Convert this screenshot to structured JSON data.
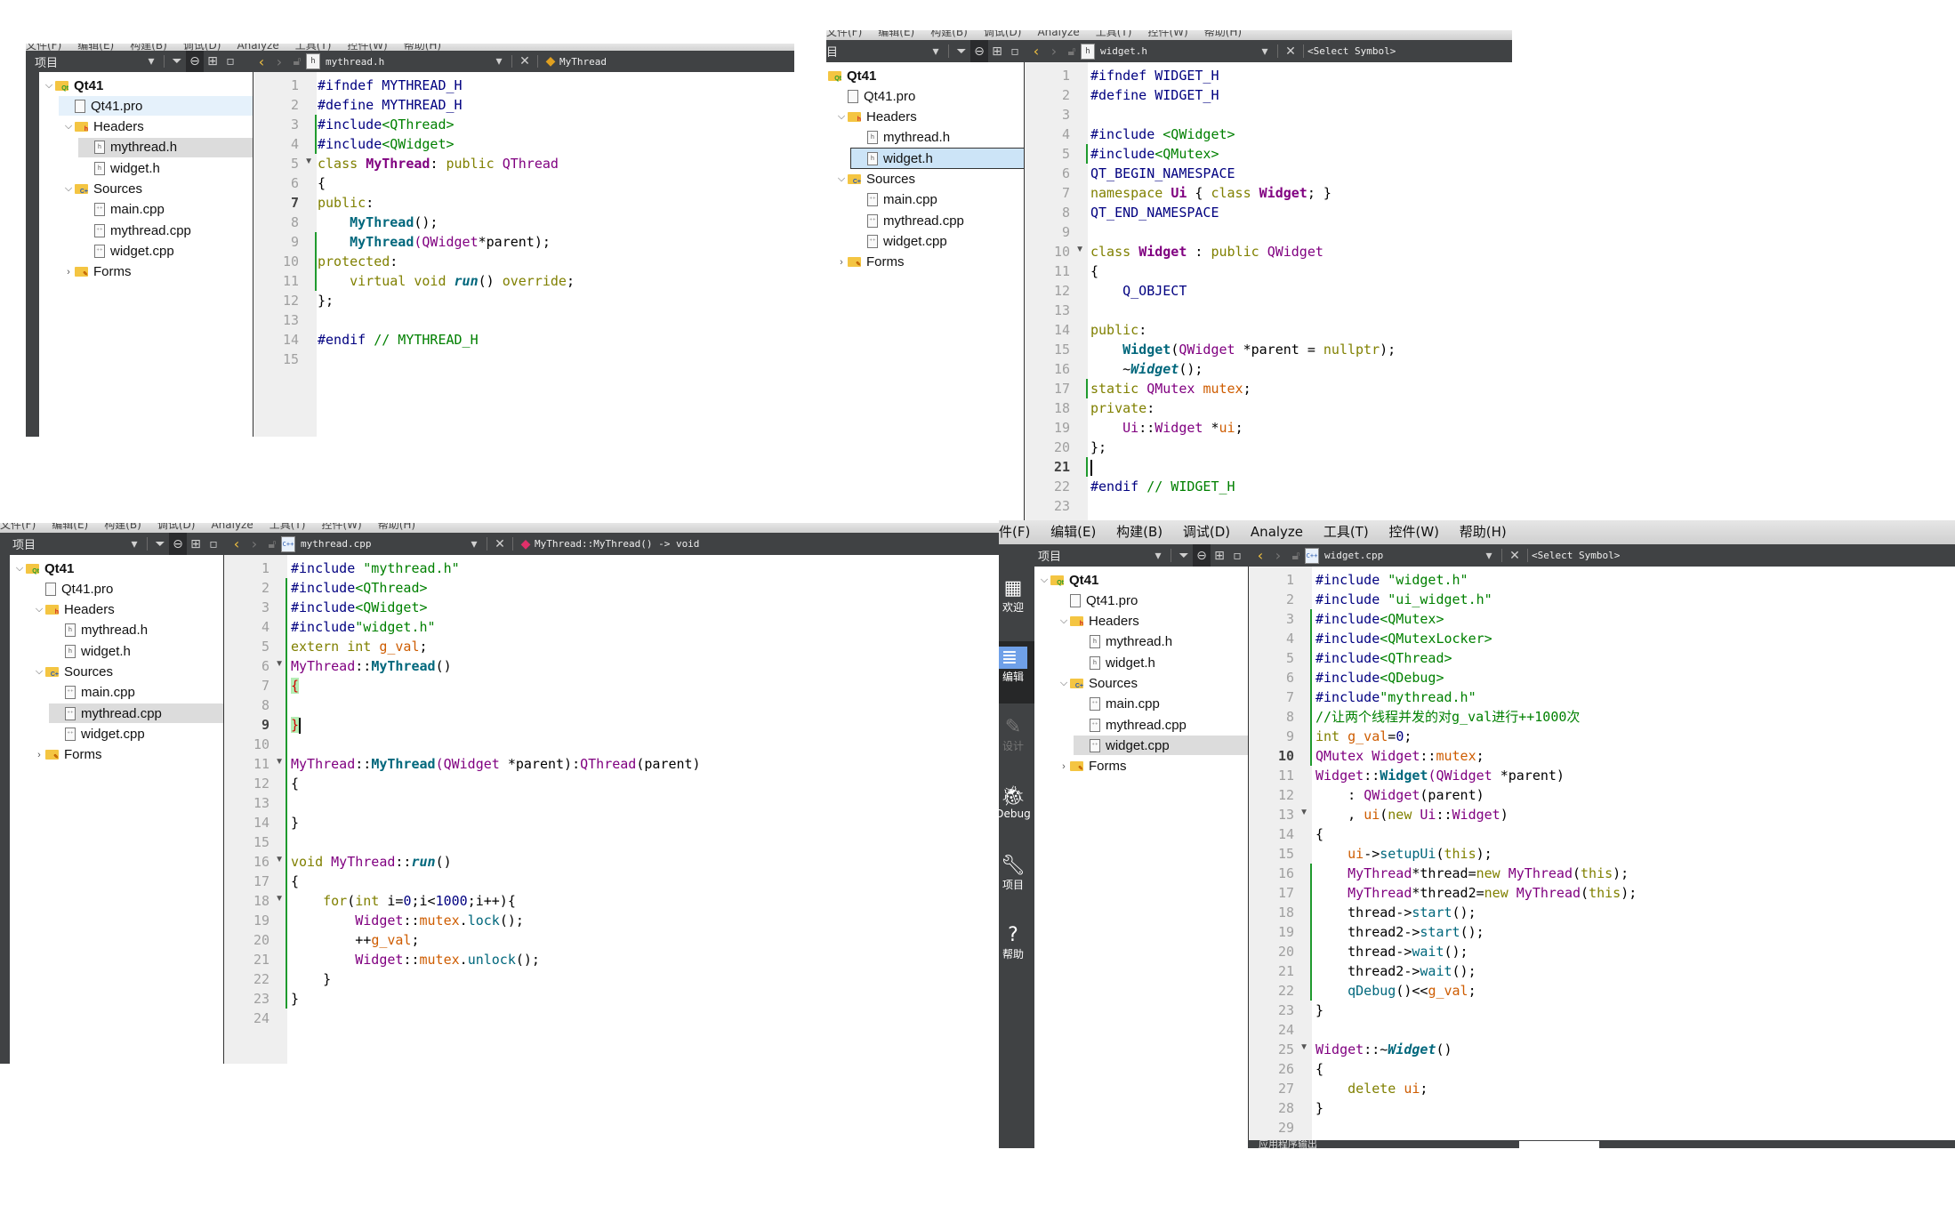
{
  "menu": {
    "items": [
      "文件(F)",
      "编辑(E)",
      "构建(B)",
      "调试(D)",
      "Analyze",
      "工具(T)",
      "控件(W)",
      "帮助(H)"
    ],
    "partial_first": "件(F)"
  },
  "toolbar": {
    "project_label": "项目",
    "project_label_partial": "目",
    "select_symbol": "<Select Symbol>"
  },
  "tree": {
    "project": "Qt41",
    "pro_file": "Qt41.pro",
    "headers_label": "Headers",
    "headers": [
      "mythread.h",
      "widget.h"
    ],
    "sources_label": "Sources",
    "sources": [
      "main.cpp",
      "mythread.cpp",
      "widget.cpp"
    ],
    "forms_label": "Forms"
  },
  "panels": [
    {
      "id": "mythread-h",
      "open_file": "mythread.h",
      "symbol": "MyThread",
      "selected_tree_item": "mythread.h",
      "line_count": 15,
      "current_line": 7,
      "lines": [
        [
          [
            "pp",
            "#ifndef MYTHREAD_H"
          ]
        ],
        [
          [
            "pp",
            "#define MYTHREAD_H"
          ]
        ],
        [
          [
            "pp",
            "#include"
          ],
          [
            "str",
            "<QThread>"
          ]
        ],
        [
          [
            "pp",
            "#include"
          ],
          [
            "str",
            "<QWidget>"
          ]
        ],
        [
          [
            "kw",
            "class "
          ],
          [
            "clsb",
            "MyThread"
          ],
          [
            "",
            ": "
          ],
          [
            "kw",
            "public "
          ],
          [
            "typ",
            "QThread"
          ]
        ],
        [
          [
            "",
            "{"
          ]
        ],
        [
          [
            "kw",
            "public"
          ],
          [
            "",
            ":"
          ]
        ],
        [
          [
            "",
            "    "
          ],
          [
            "fnb",
            "MyThread"
          ],
          [
            "",
            "();"
          ]
        ],
        [
          [
            "",
            "    "
          ],
          [
            "fnb",
            "MyThread"
          ],
          [
            "typ",
            "(QWidget"
          ],
          [
            "",
            "*parent);"
          ]
        ],
        [
          [
            "kw",
            "protected"
          ],
          [
            "",
            ":"
          ]
        ],
        [
          [
            "",
            "    "
          ],
          [
            "kw",
            "virtual void "
          ],
          [
            "fni",
            "run"
          ],
          [
            "",
            "() "
          ],
          [
            "kw",
            "override"
          ],
          [
            "",
            ";"
          ]
        ],
        [
          [
            "",
            "};"
          ]
        ],
        [
          [
            "",
            ""
          ]
        ],
        [
          [
            "pp",
            "#endif "
          ],
          [
            "cmt",
            "// MYTHREAD_H"
          ]
        ],
        [
          [
            "",
            ""
          ]
        ]
      ]
    },
    {
      "id": "widget-h",
      "open_file": "widget.h",
      "symbol": "<Select Symbol>",
      "selected_tree_item": "widget.h",
      "line_count": 23,
      "current_line": 21,
      "lines": [
        [
          [
            "pp",
            "#ifndef WIDGET_H"
          ]
        ],
        [
          [
            "pp",
            "#define WIDGET_H"
          ]
        ],
        [
          [
            "",
            ""
          ]
        ],
        [
          [
            "pp",
            "#include "
          ],
          [
            "str",
            "<QWidget>"
          ]
        ],
        [
          [
            "pp",
            "#include"
          ],
          [
            "str",
            "<QMutex>"
          ]
        ],
        [
          [
            "pp",
            "QT_BEGIN_NAMESPACE"
          ]
        ],
        [
          [
            "kw",
            "namespace "
          ],
          [
            "clsb",
            "Ui"
          ],
          [
            "",
            " { "
          ],
          [
            "kw",
            "class "
          ],
          [
            "clsb",
            "Widget"
          ],
          [
            "",
            "; }"
          ]
        ],
        [
          [
            "pp",
            "QT_END_NAMESPACE"
          ]
        ],
        [
          [
            "",
            ""
          ]
        ],
        [
          [
            "kw",
            "class "
          ],
          [
            "clsb",
            "Widget"
          ],
          [
            "",
            " : "
          ],
          [
            "kw",
            "public "
          ],
          [
            "typ",
            "QWidget"
          ]
        ],
        [
          [
            "",
            "{"
          ]
        ],
        [
          [
            "",
            "    "
          ],
          [
            "pp",
            "Q_OBJECT"
          ]
        ],
        [
          [
            "",
            ""
          ]
        ],
        [
          [
            "kw",
            "public"
          ],
          [
            "",
            ":"
          ]
        ],
        [
          [
            "",
            "    "
          ],
          [
            "fnb",
            "Widget"
          ],
          [
            "",
            "("
          ],
          [
            "typ",
            "QWidget"
          ],
          [
            "",
            " *parent = "
          ],
          [
            "kw",
            "nullptr"
          ],
          [
            "",
            ");"
          ]
        ],
        [
          [
            "",
            "    ~"
          ],
          [
            "fni",
            "Widget"
          ],
          [
            "",
            "();"
          ]
        ],
        [
          [
            "kw",
            "static "
          ],
          [
            "typ",
            "QMutex "
          ],
          [
            "mem",
            "mutex"
          ],
          [
            "",
            ";"
          ]
        ],
        [
          [
            "kw",
            "private"
          ],
          [
            "",
            ":"
          ]
        ],
        [
          [
            "",
            "    "
          ],
          [
            "typ",
            "Ui"
          ],
          [
            "",
            "::"
          ],
          [
            "typ",
            "Widget"
          ],
          [
            "",
            " *"
          ],
          [
            "mem",
            "ui"
          ],
          [
            "",
            ";"
          ]
        ],
        [
          [
            "",
            "};"
          ]
        ],
        [
          [
            "caret",
            ""
          ]
        ],
        [
          [
            "pp",
            "#endif "
          ],
          [
            "cmt",
            "// WIDGET_H"
          ]
        ],
        [
          [
            "",
            ""
          ]
        ]
      ]
    },
    {
      "id": "mythread-cpp",
      "open_file": "mythread.cpp",
      "symbol": "MyThread::MyThread() -> void",
      "selected_tree_item": "mythread.cpp",
      "line_count": 24,
      "current_line": 9,
      "lines": [
        [
          [
            "pp",
            "#include "
          ],
          [
            "str",
            "\"mythread.h\""
          ]
        ],
        [
          [
            "pp",
            "#include"
          ],
          [
            "str",
            "<QThread>"
          ]
        ],
        [
          [
            "pp",
            "#include"
          ],
          [
            "str",
            "<QWidget>"
          ]
        ],
        [
          [
            "pp",
            "#include"
          ],
          [
            "str",
            "\"widget.h\""
          ]
        ],
        [
          [
            "kw",
            "extern int "
          ],
          [
            "mem",
            "g_val"
          ],
          [
            "",
            ";"
          ]
        ],
        [
          [
            "typ",
            "MyThread"
          ],
          [
            "",
            "::"
          ],
          [
            "fnb",
            "MyThread"
          ],
          [
            "",
            "()"
          ]
        ],
        [
          [
            "brhl",
            "{"
          ]
        ],
        [
          [
            "",
            ""
          ]
        ],
        [
          [
            "brhl",
            "}"
          ],
          [
            "caret",
            ""
          ]
        ],
        [
          [
            "",
            ""
          ]
        ],
        [
          [
            "typ",
            "MyThread"
          ],
          [
            "",
            "::"
          ],
          [
            "fnb",
            "MyThread"
          ],
          [
            "typ",
            "(QWidget"
          ],
          [
            "",
            " *parent):"
          ],
          [
            "typ",
            "QThread"
          ],
          [
            "",
            "(parent)"
          ]
        ],
        [
          [
            "",
            "{"
          ]
        ],
        [
          [
            "",
            ""
          ]
        ],
        [
          [
            "",
            "}"
          ]
        ],
        [
          [
            "",
            ""
          ]
        ],
        [
          [
            "kw",
            "void "
          ],
          [
            "typ",
            "MyThread"
          ],
          [
            "",
            "::"
          ],
          [
            "fni",
            "run"
          ],
          [
            "",
            "()"
          ]
        ],
        [
          [
            "",
            "{"
          ]
        ],
        [
          [
            "",
            "    "
          ],
          [
            "kw",
            "for"
          ],
          [
            "",
            "("
          ],
          [
            "kw",
            "int "
          ],
          [
            "",
            "i="
          ],
          [
            "num",
            "0"
          ],
          [
            "",
            ";i<"
          ],
          [
            "num",
            "1000"
          ],
          [
            "",
            ";i++){"
          ]
        ],
        [
          [
            "",
            "        "
          ],
          [
            "typ",
            "Widget"
          ],
          [
            "",
            "::"
          ],
          [
            "mem",
            "mutex"
          ],
          [
            "",
            "."
          ],
          [
            "fn",
            "lock"
          ],
          [
            "",
            "();"
          ]
        ],
        [
          [
            "",
            "        ++"
          ],
          [
            "mem",
            "g_val"
          ],
          [
            "",
            ";"
          ]
        ],
        [
          [
            "",
            "        "
          ],
          [
            "typ",
            "Widget"
          ],
          [
            "",
            "::"
          ],
          [
            "mem",
            "mutex"
          ],
          [
            "",
            "."
          ],
          [
            "fn",
            "unlock"
          ],
          [
            "",
            "();"
          ]
        ],
        [
          [
            "",
            "    }"
          ]
        ],
        [
          [
            "",
            "}"
          ]
        ],
        [
          [
            "",
            ""
          ]
        ]
      ]
    },
    {
      "id": "widget-cpp",
      "open_file": "widget.cpp",
      "symbol": "<Select Symbol>",
      "selected_tree_item": "widget.cpp",
      "line_count": 29,
      "current_line": 10,
      "lines": [
        [
          [
            "pp",
            "#include "
          ],
          [
            "str",
            "\"widget.h\""
          ]
        ],
        [
          [
            "pp",
            "#include "
          ],
          [
            "str",
            "\"ui_widget.h\""
          ]
        ],
        [
          [
            "pp",
            "#include"
          ],
          [
            "str",
            "<QMutex>"
          ]
        ],
        [
          [
            "pp",
            "#include"
          ],
          [
            "str",
            "<QMutexLocker>"
          ]
        ],
        [
          [
            "pp",
            "#include"
          ],
          [
            "str",
            "<QThread>"
          ]
        ],
        [
          [
            "pp",
            "#include"
          ],
          [
            "str",
            "<QDebug>"
          ]
        ],
        [
          [
            "pp",
            "#include"
          ],
          [
            "str",
            "\"mythread.h\""
          ]
        ],
        [
          [
            "cmt",
            "//让两个线程并发的对g_val进行++1000次"
          ]
        ],
        [
          [
            "kw",
            "int "
          ],
          [
            "mem",
            "g_val"
          ],
          [
            "",
            "="
          ],
          [
            "num",
            "0"
          ],
          [
            "",
            ";"
          ]
        ],
        [
          [
            "typ",
            "QMutex Widget"
          ],
          [
            "",
            "::"
          ],
          [
            "mem",
            "mutex"
          ],
          [
            "",
            ";"
          ]
        ],
        [
          [
            "typ",
            "Widget"
          ],
          [
            "",
            "::"
          ],
          [
            "fnb",
            "Widget"
          ],
          [
            "typ",
            "(QWidget"
          ],
          [
            "",
            " *parent)"
          ]
        ],
        [
          [
            "",
            "    : "
          ],
          [
            "typ",
            "QWidget"
          ],
          [
            "",
            "(parent)"
          ]
        ],
        [
          [
            "",
            "    , "
          ],
          [
            "mem",
            "ui"
          ],
          [
            "",
            "("
          ],
          [
            "kw",
            "new "
          ],
          [
            "typ",
            "Ui"
          ],
          [
            "",
            "::"
          ],
          [
            "typ",
            "Widget"
          ],
          [
            "",
            ")"
          ]
        ],
        [
          [
            "",
            "{"
          ]
        ],
        [
          [
            "",
            "    "
          ],
          [
            "mem",
            "ui"
          ],
          [
            "",
            "->"
          ],
          [
            "fn",
            "setupUi"
          ],
          [
            "",
            "("
          ],
          [
            "kw",
            "this"
          ],
          [
            "",
            ");"
          ]
        ],
        [
          [
            "",
            "    "
          ],
          [
            "typ",
            "MyThread"
          ],
          [
            "",
            "*thread="
          ],
          [
            "kw",
            "new "
          ],
          [
            "typ",
            "MyThread"
          ],
          [
            "",
            "("
          ],
          [
            "kw",
            "this"
          ],
          [
            "",
            ");"
          ]
        ],
        [
          [
            "",
            "    "
          ],
          [
            "typ",
            "MyThread"
          ],
          [
            "",
            "*thread2="
          ],
          [
            "kw",
            "new "
          ],
          [
            "typ",
            "MyThread"
          ],
          [
            "",
            "("
          ],
          [
            "kw",
            "this"
          ],
          [
            "",
            ");"
          ]
        ],
        [
          [
            "",
            "    thread->"
          ],
          [
            "fn",
            "start"
          ],
          [
            "",
            "();"
          ]
        ],
        [
          [
            "",
            "    thread2->"
          ],
          [
            "fn",
            "start"
          ],
          [
            "",
            "();"
          ]
        ],
        [
          [
            "",
            "    thread->"
          ],
          [
            "fn",
            "wait"
          ],
          [
            "",
            "();"
          ]
        ],
        [
          [
            "",
            "    thread2->"
          ],
          [
            "fn",
            "wait"
          ],
          [
            "",
            "();"
          ]
        ],
        [
          [
            "",
            "    "
          ],
          [
            "fn",
            "qDebug"
          ],
          [
            "",
            "()<<"
          ],
          [
            "mem",
            "g_val"
          ],
          [
            "",
            ";"
          ]
        ],
        [
          [
            "",
            "}"
          ]
        ],
        [
          [
            "",
            ""
          ]
        ],
        [
          [
            "typ",
            "Widget"
          ],
          [
            "",
            "::~"
          ],
          [
            "fni",
            "Widget"
          ],
          [
            "",
            "()"
          ]
        ],
        [
          [
            "",
            "{"
          ]
        ],
        [
          [
            "",
            "    "
          ],
          [
            "kw",
            "delete "
          ],
          [
            "mem",
            "ui"
          ],
          [
            "",
            ";"
          ]
        ],
        [
          [
            "",
            "}"
          ]
        ],
        [
          [
            "",
            ""
          ]
        ]
      ]
    }
  ],
  "modebar": {
    "items": [
      {
        "icon": "grid-icon",
        "label": "欢迎"
      },
      {
        "icon": "edit-doc-icon",
        "label": "编辑",
        "active": true
      },
      {
        "icon": "pencil-icon",
        "label": "设计",
        "disabled": true
      },
      {
        "icon": "bug-icon",
        "label": "Debug"
      },
      {
        "icon": "wrench-icon",
        "label": "项目"
      },
      {
        "icon": "help-icon",
        "label": "帮助"
      }
    ]
  },
  "output_strip": {
    "label": "应用程序输出"
  }
}
